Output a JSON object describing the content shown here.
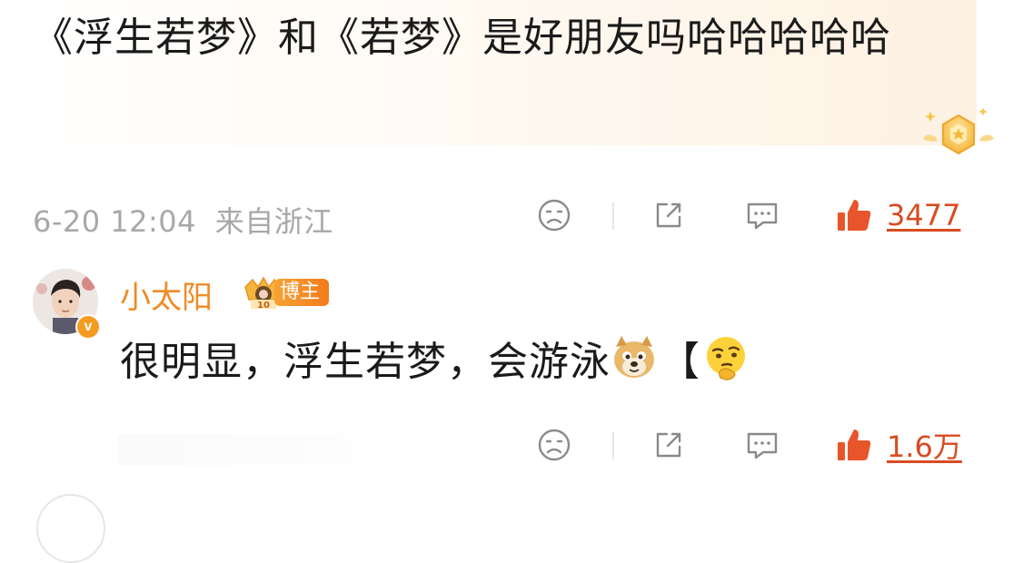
{
  "post": {
    "text": "《浮生若梦》和《若梦》是好朋友吗哈哈哈哈哈",
    "timestamp": "6-20 12:04",
    "source": "来自浙江",
    "like_count": "3477"
  },
  "comment": {
    "username": "小太阳",
    "author_tag": "博主",
    "verified_mark": "v",
    "badge_level": "10",
    "text": "很明显，浮生若梦，会游泳",
    "bracket": "【",
    "emojis": [
      "doge-emoji",
      "thinking-emoji"
    ],
    "like_count": "1.6万"
  },
  "colors": {
    "accent_orange": "#f08a24",
    "like_red": "#d94b22",
    "meta_gray": "#a8a8a8"
  },
  "icons": [
    "frown-face-icon",
    "share-icon",
    "comment-bubble-icon",
    "thumbs-up-icon"
  ]
}
